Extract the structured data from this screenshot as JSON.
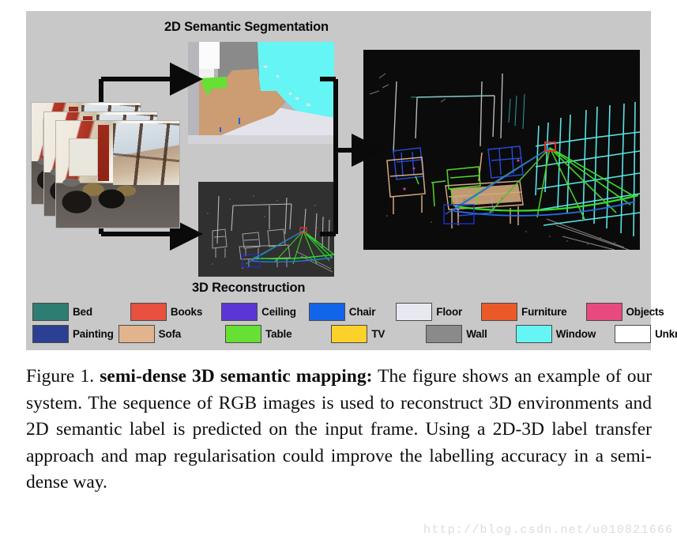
{
  "figure": {
    "panel_titles": {
      "segmentation": "2D Semantic Segmentation",
      "reconstruction": "3D Reconstruction"
    },
    "background_color": "#c8c8c8",
    "images": {
      "rgb_input_stack": "rgb-input-image-stack",
      "segmentation_map": "2d-semantic-segmentation-map",
      "reconstruction_cloud": "3d-reconstruction-point-cloud",
      "semantic_map": "3d-semantic-map-point-cloud"
    }
  },
  "legend": {
    "rows": [
      [
        {
          "label": "Bed",
          "color": "#2e7d73"
        },
        {
          "label": "Books",
          "color": "#e8503f"
        },
        {
          "label": "Ceiling",
          "color": "#5b35d6"
        },
        {
          "label": "Chair",
          "color": "#1265e8"
        },
        {
          "label": "Floor",
          "color": "#e8e8f0"
        },
        {
          "label": "Furniture",
          "color": "#ea5a28"
        },
        {
          "label": "Objects",
          "color": "#e8497f"
        }
      ],
      [
        {
          "label": "Painting",
          "color": "#2b3f93"
        },
        {
          "label": "Sofa",
          "color": "#e2b48d"
        },
        {
          "label": "Table",
          "color": "#66e033"
        },
        {
          "label": "TV",
          "color": "#fcd12a"
        },
        {
          "label": "Wall",
          "color": "#8a8a8a"
        },
        {
          "label": "Window",
          "color": "#66f5f5"
        },
        {
          "label": "Unknown",
          "color": "#ffffff"
        }
      ]
    ]
  },
  "caption": {
    "prefix": "Figure 1.",
    "bold_title": "semi-dense 3D semantic mapping:",
    "body": "The figure shows an example of our system. The sequence of RGB images is used to reconstruct 3D environments and 2D semantic label is predicted on the input frame. Using a 2D-3D label transfer approach and map regularisation could improve the labelling accuracy in a semi-dense way."
  },
  "watermark": {
    "text": "http://blog.csdn.net/u010821666"
  }
}
